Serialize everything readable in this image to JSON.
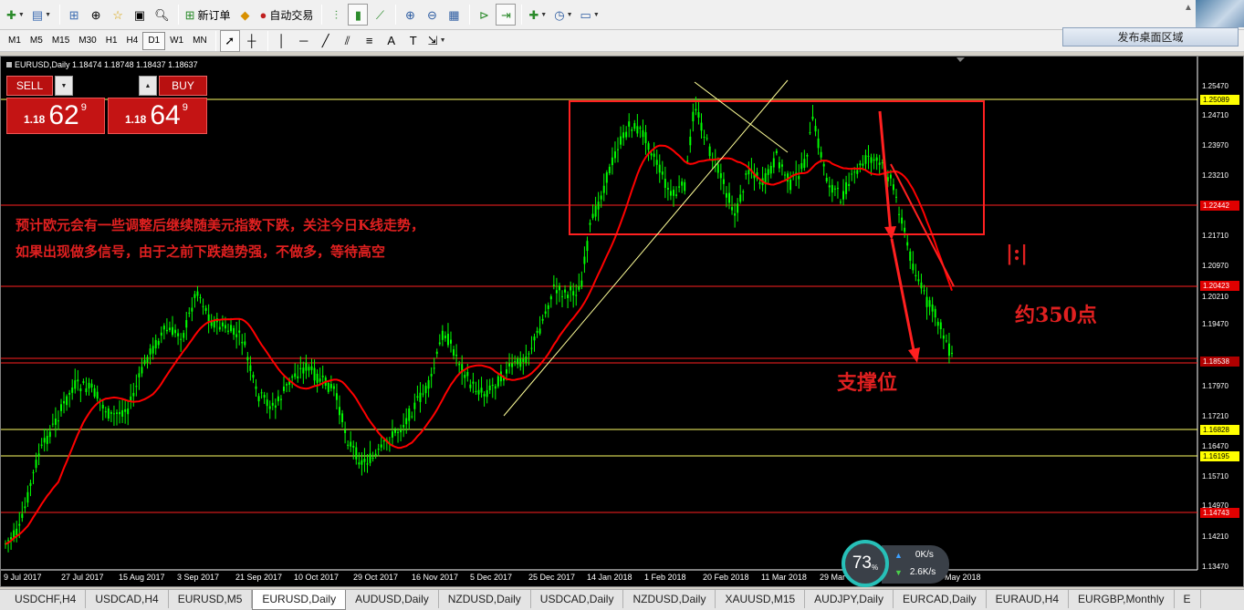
{
  "toolbar": {
    "new_order_label": "新订单",
    "auto_trade_label": "自动交易",
    "desktop_area_label": "发布桌面区域",
    "timeframes": [
      "M1",
      "M5",
      "M15",
      "M30",
      "H1",
      "H4",
      "D1",
      "W1",
      "MN"
    ],
    "active_timeframe": "D1"
  },
  "chart_header": {
    "symbol_line": "EURUSD,Daily  1.18474 1.18748 1.18437 1.18637"
  },
  "trade_panel": {
    "sell_label": "SELL",
    "buy_label": "BUY",
    "sell_price_prefix": "1.18",
    "sell_price_big": "62",
    "sell_price_sup": "9",
    "buy_price_prefix": "1.18",
    "buy_price_big": "64",
    "buy_price_sup": "9"
  },
  "annotations": {
    "line1": "预计欧元会有一些调整后继续随美元指数下跌，关注今日K线走势，",
    "line2": "如果出现做多信号，由于之前下跌趋势强，不做多，等待高空",
    "points": "约350点",
    "support": "支撑位",
    "bracket": "|:|"
  },
  "price_axis": {
    "labels": [
      "1.25470",
      "1.24710",
      "1.23970",
      "1.23210",
      "1.21710",
      "1.20970",
      "1.20210",
      "1.19470",
      "1.17970",
      "1.17210",
      "1.16470",
      "1.15710",
      "1.14970",
      "1.14210",
      "1.13470"
    ],
    "tags": [
      {
        "value": "1.25089",
        "style": "yellow"
      },
      {
        "value": "1.22442",
        "style": "red"
      },
      {
        "value": "1.20423",
        "style": "red"
      },
      {
        "value": "1.18538",
        "style": "dark"
      },
      {
        "value": "1.16828",
        "style": "yellow"
      },
      {
        "value": "1.16195",
        "style": "yellow"
      },
      {
        "value": "1.14743",
        "style": "red"
      }
    ]
  },
  "date_axis": [
    "9 Jul 2017",
    "27 Jul 2017",
    "15 Aug 2017",
    "3 Sep 2017",
    "21 Sep 2017",
    "10 Oct 2017",
    "29 Oct 2017",
    "16 Nov 2017",
    "5 Dec 2017",
    "25 Dec 2017",
    "14 Jan 2018",
    "1 Feb 2018",
    "20 Feb 2018",
    "11 Mar 2018",
    "29 Mar 2018",
    "May 2018"
  ],
  "net_widget": {
    "percent": "73",
    "percent_unit": "%",
    "up_speed": "0K/s",
    "down_speed": "2.6K/s"
  },
  "tabs": [
    "USDCHF,H4",
    "USDCAD,H4",
    "EURUSD,M5",
    "EURUSD,Daily",
    "AUDUSD,Daily",
    "NZDUSD,Daily",
    "USDCAD,Daily",
    "NZDUSD,Daily",
    "XAUUSD,M15",
    "AUDJPY,Daily",
    "EURCAD,Daily",
    "EURAUD,H4",
    "EURGBP,Monthly",
    "E"
  ],
  "active_tab": "EURUSD,Daily",
  "colors": {
    "candle": "#00ff00",
    "ma": "#ff0000",
    "support_line": "#ffff66",
    "resistance_line": "#ff2020",
    "background": "#000000"
  }
}
